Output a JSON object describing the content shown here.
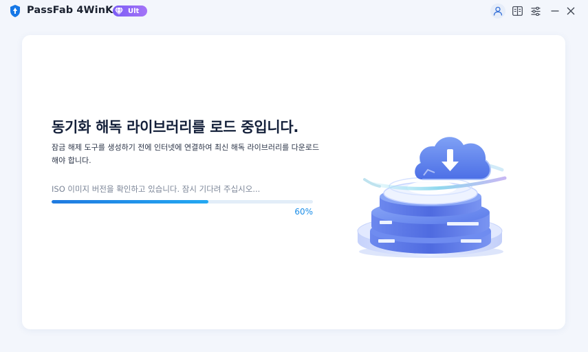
{
  "app": {
    "name": "PassFab 4WinKey",
    "edition_badge": "Ult"
  },
  "titlebar": {
    "icons": [
      "account-icon",
      "guide-icon",
      "settings-icon",
      "minimize-icon",
      "close-icon"
    ],
    "accent_color": "#1a8de8"
  },
  "main": {
    "heading": "동기화 해독 라이브러리를 로드 중입니다.",
    "description": "잠금 해제 도구를 생성하기 전에 인터넷에 연결하여 최신 해독 라이브러리를 다운로드해야 합니다.",
    "status_text": "ISO 이미지 버전을 확인하고 있습니다. 잠시 기다려 주십시오...",
    "progress": 60,
    "progress_label": "60%"
  }
}
